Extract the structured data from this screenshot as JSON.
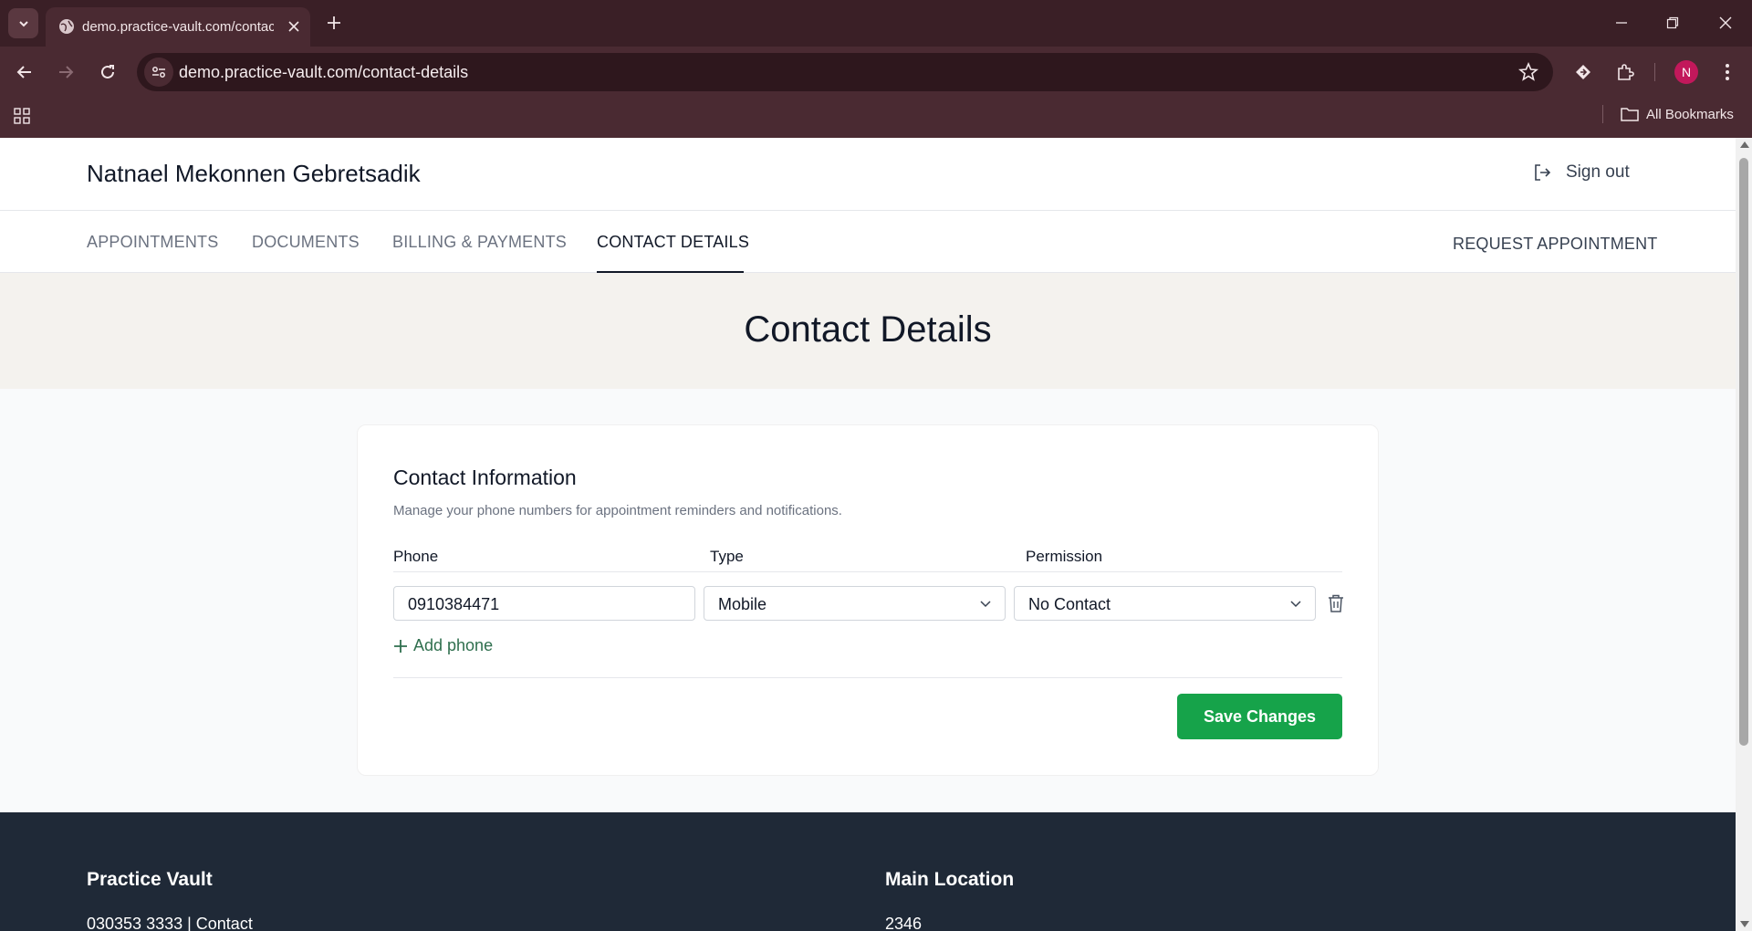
{
  "browser": {
    "tab_title": "demo.practice-vault.com/contact-details",
    "url": "demo.practice-vault.com/contact-details",
    "avatar_initial": "N",
    "all_bookmarks_label": "All Bookmarks",
    "accent_color": "#4a2a32"
  },
  "header": {
    "patient_name": "Natnael Mekonnen Gebretsadik",
    "sign_out_label": "Sign out"
  },
  "nav": {
    "items": [
      {
        "label": "APPOINTMENTS"
      },
      {
        "label": "DOCUMENTS"
      },
      {
        "label": "BILLING & PAYMENTS"
      },
      {
        "label": "CONTACT DETAILS",
        "active": true
      }
    ],
    "request_appointment_label": "REQUEST APPOINTMENT"
  },
  "page": {
    "title": "Contact Details"
  },
  "contact_form": {
    "title": "Contact Information",
    "description": "Manage your phone numbers for appointment reminders and notifications.",
    "columns": {
      "phone": "Phone",
      "type": "Type",
      "permission": "Permission"
    },
    "rows": [
      {
        "phone": "0910384471",
        "type": "Mobile",
        "permission": "No Contact"
      }
    ],
    "add_phone_label": "Add phone",
    "save_label": "Save Changes",
    "save_color": "#16a34a"
  },
  "footer": {
    "brand": "Practice Vault",
    "contact_line": "030353 3333 | Contact",
    "location_title": "Main Location",
    "location_line": "2346"
  }
}
